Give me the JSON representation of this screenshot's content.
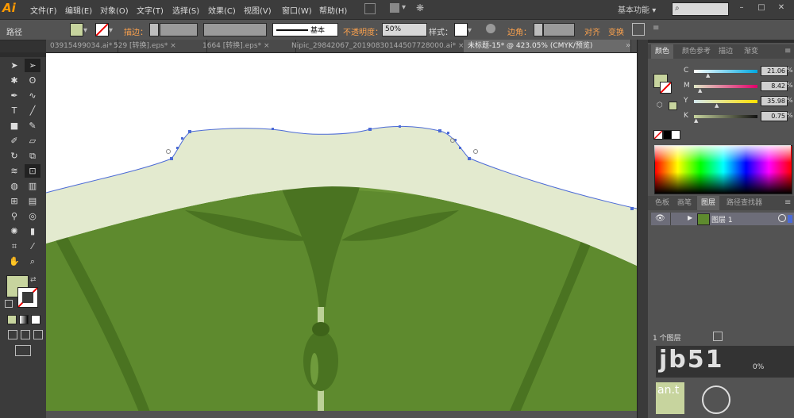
{
  "app": {
    "logo": "Ai"
  },
  "menu": [
    "文件(F)",
    "编辑(E)",
    "对象(O)",
    "文字(T)",
    "选择(S)",
    "效果(C)",
    "视图(V)",
    "窗口(W)",
    "帮助(H)"
  ],
  "workspace": {
    "label": "基本功能",
    "arrow": "▾"
  },
  "control": {
    "object_type": "路径",
    "stroke_label": "描边：",
    "stroke_profile": "基本",
    "opacity_label": "不透明度：",
    "opacity_value": "50%",
    "style_label": "样式：",
    "corner_label": "边角：",
    "align_label": "对齐",
    "transform_label": "变换"
  },
  "tabs": [
    {
      "label": "03915499034.ai* ×",
      "active": false
    },
    {
      "label": "529 [转换].eps* ×",
      "active": false
    },
    {
      "label": "1664 [转换].eps* ×",
      "active": false
    },
    {
      "label": "Nipic_29842067_20190830144507728000.ai* ×",
      "active": false
    },
    {
      "label": "未标题-15* @ 423.05% (CMYK/预览)",
      "active": true
    }
  ],
  "color_panel": {
    "tabs": [
      "颜色",
      "颜色参考",
      "描边",
      "渐变"
    ],
    "channels": [
      {
        "name": "C",
        "value": "21.06",
        "color": "#00a8e0"
      },
      {
        "name": "M",
        "value": "8.42",
        "color": "#e0006a"
      },
      {
        "name": "Y",
        "value": "35.98",
        "color": "#ffe100"
      },
      {
        "name": "K",
        "value": "0.75",
        "color": "#222222"
      }
    ],
    "pct": "%",
    "fill_color": "#c7d49e"
  },
  "layers_panel": {
    "tabs": [
      "色板",
      "画笔",
      "图层",
      "路径查找器"
    ],
    "layer_name": "图层 1",
    "count": "1 个图层"
  },
  "watermark": {
    "text": "jb51",
    "sub": "an.t",
    "pct": "0%"
  },
  "colors": {
    "body_green": "#5e8a2e",
    "dark_green": "#4a7321",
    "collar": "#e3eacf",
    "selection": "#4c6bd6"
  }
}
